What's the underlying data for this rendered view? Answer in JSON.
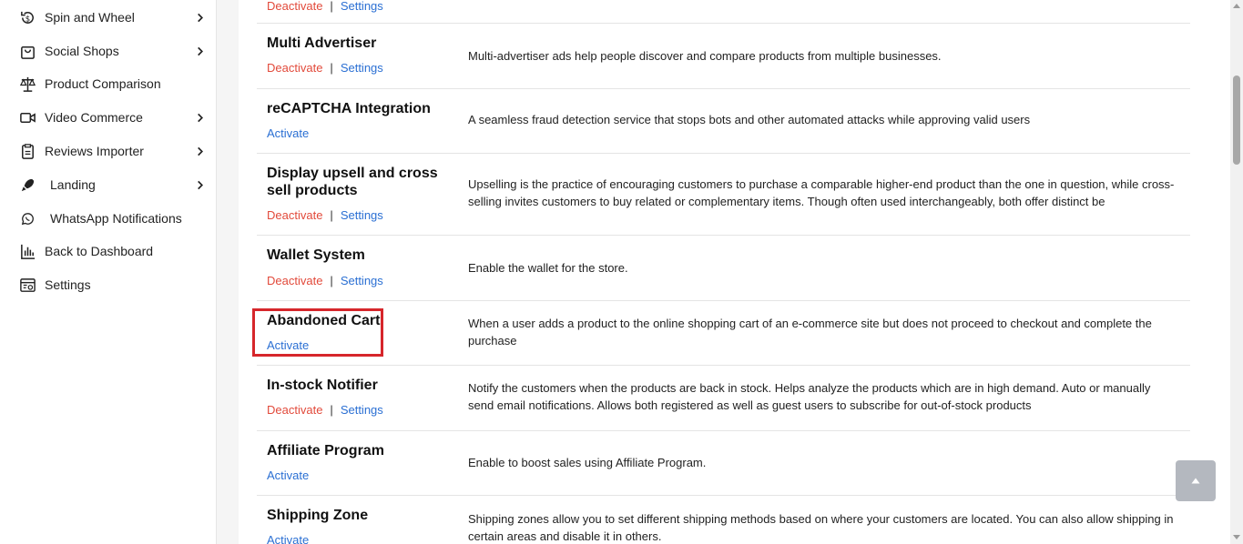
{
  "sidebar": {
    "items": [
      {
        "label": "Spin and Wheel",
        "icon": "dollar-cycle-icon",
        "has_submenu": true
      },
      {
        "label": "Social Shops",
        "icon": "shopping-bag-icon",
        "has_submenu": true
      },
      {
        "label": "Product Comparison",
        "icon": "scale-icon",
        "has_submenu": false
      },
      {
        "label": "Video Commerce",
        "icon": "video-camera-icon",
        "has_submenu": true
      },
      {
        "label": "Reviews Importer",
        "icon": "clipboard-icon",
        "has_submenu": true
      },
      {
        "label": "Landing",
        "icon": "rocket-icon",
        "has_submenu": true
      },
      {
        "label": "WhatsApp Notifications",
        "icon": "whatsapp-icon",
        "has_submenu": false
      },
      {
        "label": "Back to Dashboard",
        "icon": "bar-chart-icon",
        "has_submenu": false
      },
      {
        "label": "Settings",
        "icon": "browser-settings-icon",
        "has_submenu": false
      }
    ]
  },
  "addons": [
    {
      "title": "",
      "deactivate_label": "Deactivate",
      "settings_label": "Settings",
      "separator": "|",
      "description": ""
    },
    {
      "title": "Multi Advertiser",
      "deactivate_label": "Deactivate",
      "settings_label": "Settings",
      "separator": "|",
      "description": "Multi-advertiser ads help people discover and compare products from multiple businesses."
    },
    {
      "title": "reCAPTCHA Integration",
      "activate_label": "Activate",
      "description": "A seamless fraud detection service that stops bots and other automated attacks while approving valid users"
    },
    {
      "title": "Display upsell and cross sell products",
      "deactivate_label": "Deactivate",
      "settings_label": "Settings",
      "separator": "|",
      "description": "Upselling is the practice of encouraging customers to purchase a comparable higher-end product than the one in question, while cross-selling invites customers to buy related or complementary items. Though often used interchangeably, both offer distinct be"
    },
    {
      "title": "Wallet System",
      "deactivate_label": "Deactivate",
      "settings_label": "Settings",
      "separator": "|",
      "description": "Enable the wallet for the store."
    },
    {
      "title": "Abandoned Cart",
      "activate_label": "Activate",
      "description": "When a user adds a product to the online shopping cart of an e-commerce site but does not proceed to checkout and complete the purchase"
    },
    {
      "title": "In-stock Notifier",
      "deactivate_label": "Deactivate",
      "settings_label": "Settings",
      "separator": "|",
      "description": "Notify the customers when the products are back in stock. Helps analyze the products which are in high demand. Auto or manually send email notifications. Allows both registered as well as guest users to subscribe for out-of-stock products"
    },
    {
      "title": "Affiliate Program",
      "activate_label": "Activate",
      "description": "Enable to boost sales using Affiliate Program."
    },
    {
      "title": "Shipping Zone",
      "activate_label": "Activate",
      "description": "Shipping zones allow you to set different shipping methods based on where your customers are located. You can also allow shipping in certain areas and disable it in others."
    }
  ],
  "colors": {
    "deactivate": "#e24a3b",
    "link": "#2a6fd3",
    "highlight_border": "#d6262b"
  }
}
